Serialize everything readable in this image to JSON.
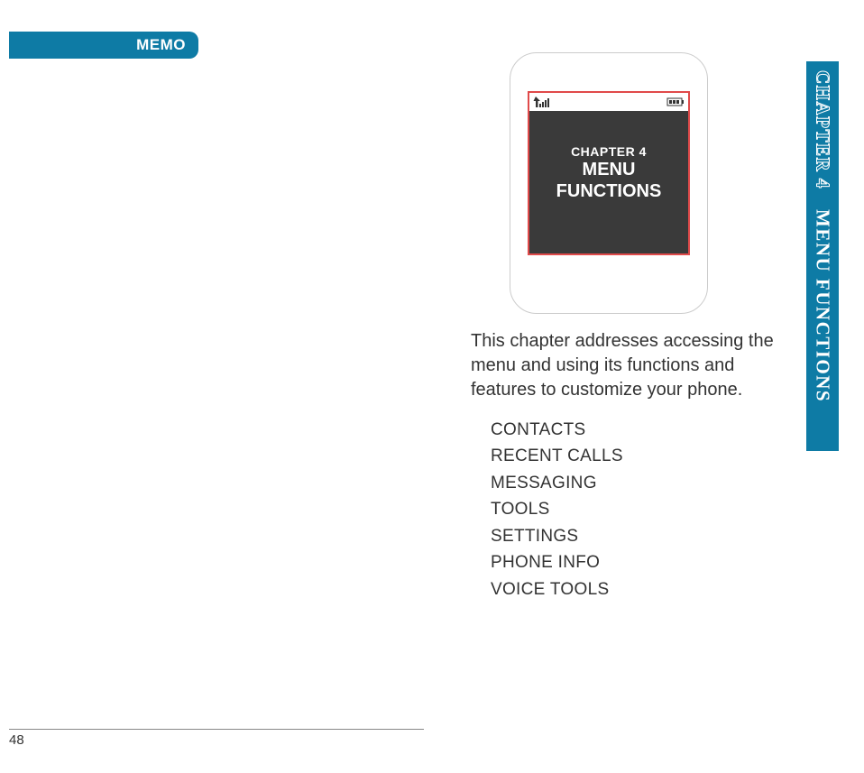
{
  "memo_label": "MEMO",
  "sidebar": {
    "chapter": "CHAPTER 4",
    "title": "MENU FUNCTIONS"
  },
  "phone": {
    "chapter_label": "CHAPTER 4",
    "title_line1": "MENU",
    "title_line2": "FUNCTIONS"
  },
  "intro": "This chapter addresses accessing the menu and using its functions and features to customize your phone.",
  "items": [
    "CONTACTS",
    "RECENT CALLS",
    "MESSAGING",
    "TOOLS",
    "SETTINGS",
    "PHONE INFO",
    "VOICE TOOLS"
  ],
  "page_number": "48"
}
